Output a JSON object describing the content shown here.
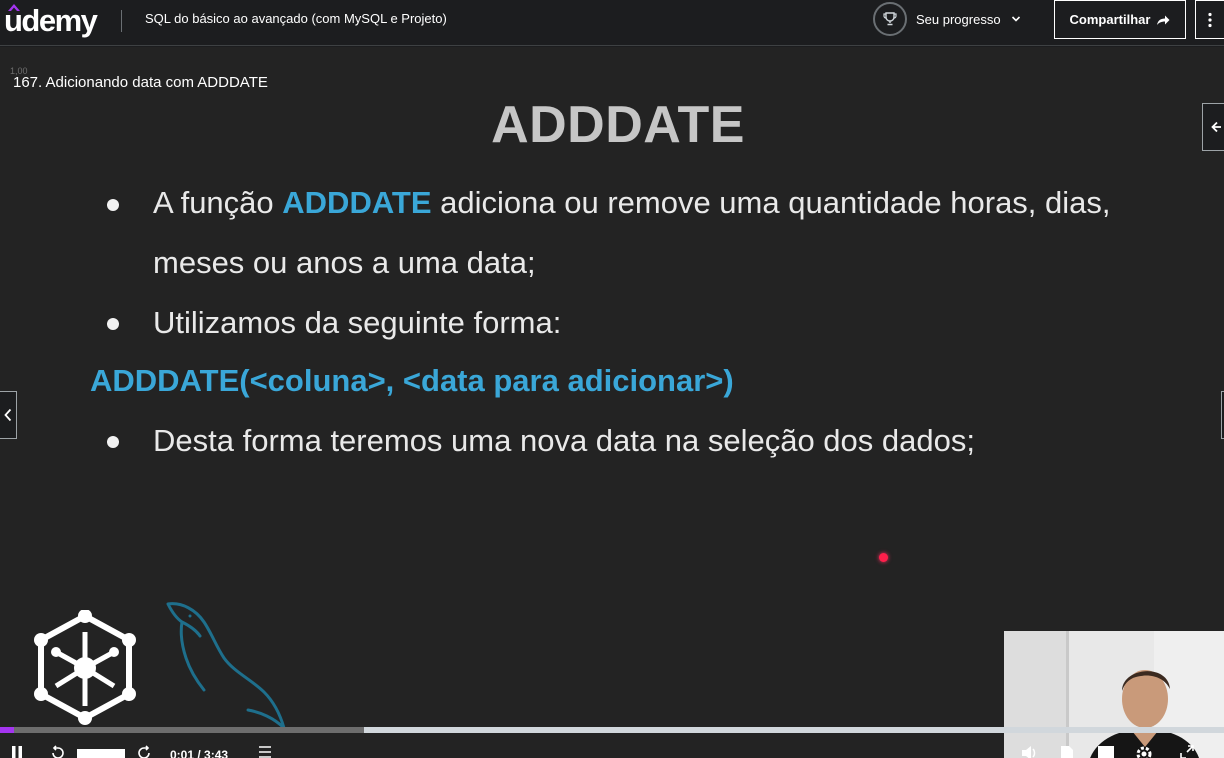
{
  "topbar": {
    "logo_text": "udemy",
    "course_title": "SQL do básico ao avançado (com MySQL e Projeto)",
    "progress_label": "Seu progresso",
    "share_label": "Compartilhar"
  },
  "player": {
    "speed_tag": "1,00",
    "lecture_title": "167. Adicionando data com ADDDATE",
    "time": "0:01 / 3:43",
    "progress_fraction": 0.297
  },
  "slide": {
    "title": "ADDDATE",
    "bullet1_prefix": "A função ",
    "bullet1_highlight": "ADDDATE",
    "bullet1_suffix": " adiciona ou remove uma quantidade horas, dias,",
    "bullet1_line2": "meses ou anos a uma data;",
    "bullet2": "Utilizamos da seguinte forma:",
    "syntax": "ADDDATE(<coluna>, <data para adicionar>)",
    "bullet3": "Desta forma teremos uma nova data na seleção dos dados;"
  },
  "colors": {
    "accent_purple": "#a435f0",
    "highlight_blue": "#3aa7d8",
    "laser_red": "#ff1f4b",
    "dolphin_blue": "#1e6f8c"
  },
  "icons": [
    "trophy-icon",
    "chevron-down-icon",
    "share-arrow-icon",
    "more-vertical-icon",
    "chevron-left-icon",
    "play-pause-icon",
    "rewind-icon",
    "forward-icon",
    "notes-icon",
    "volume-icon",
    "transcript-icon",
    "captions-icon",
    "settings-icon",
    "fullscreen-icon"
  ]
}
